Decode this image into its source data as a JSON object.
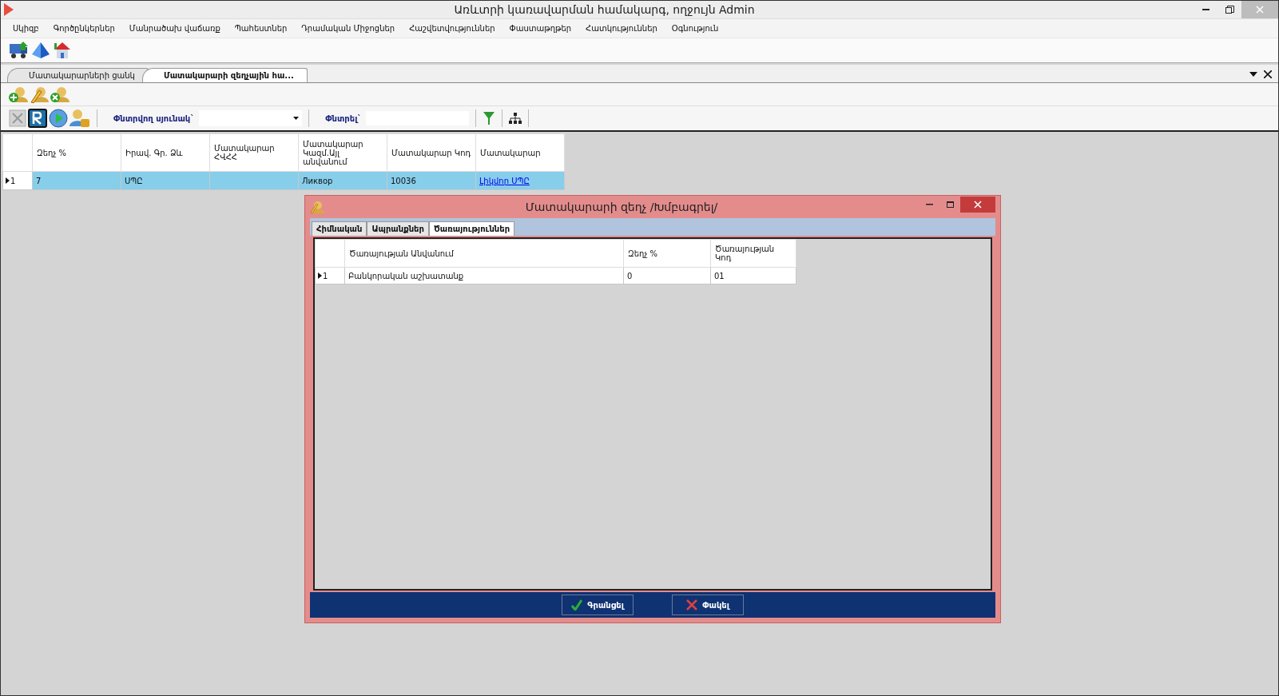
{
  "window": {
    "title": "Առևտրի կառավարման համակարգ, ողջույն Admin"
  },
  "menu": [
    "Սկիզբ",
    "Գործընկերներ",
    "Մանրածախ վաճառք",
    "Պահեստներ",
    "Դրամական Միջոցներ",
    "Հաշվետվություններ",
    "Փաստաթղթեր",
    "Հատկություններ",
    "Օգնություն"
  ],
  "doc_tabs": [
    {
      "label": "Մատակարարների ցանկ",
      "selected": false
    },
    {
      "label": "Մատակարարի զեղչային հա...",
      "selected": true
    }
  ],
  "filter": {
    "column_label": "Փնտրվող սյունակ`",
    "search_label": "Փնտրել`"
  },
  "grid": {
    "columns": [
      "Զեղչ %",
      "Իրավ. Գր. Ձև",
      "Մատակարար ՀՎՀՀ",
      "Մատակարար Կազմ.Այլ անվանում",
      "Մատակարար Կոդ",
      "Մատակարար"
    ],
    "rows": [
      {
        "number": "1",
        "current": true,
        "selected": true,
        "cells": [
          {
            "kind": "text",
            "text": "7"
          },
          {
            "kind": "text",
            "text": "ՍՊԸ"
          },
          {
            "kind": "empty"
          },
          {
            "kind": "text",
            "text": "Ликвор"
          },
          {
            "kind": "text",
            "text": "10036"
          },
          {
            "kind": "link",
            "text": "Լիկվոր ՍՊԸ"
          }
        ]
      }
    ]
  },
  "dialog": {
    "title": "Մատակարարի զեղչ /Խմբագրել/",
    "tabs": [
      {
        "label": "Հիմնական",
        "selected": false
      },
      {
        "label": "Ապրանքներ",
        "selected": false
      },
      {
        "label": "Ծառայություններ",
        "selected": true
      }
    ],
    "table": {
      "columns": [
        "Ծառայության Անվանում",
        "Զեղչ %",
        "Ծառայության Կոդ"
      ],
      "rows": [
        {
          "number": "1",
          "current": true,
          "cells": [
            "Բանկորական աշխատանք",
            "0",
            "01"
          ]
        }
      ]
    },
    "buttons": [
      {
        "label": "Գրանցել",
        "kind": "ok"
      },
      {
        "label": "Փակել",
        "kind": "cancel"
      }
    ]
  }
}
